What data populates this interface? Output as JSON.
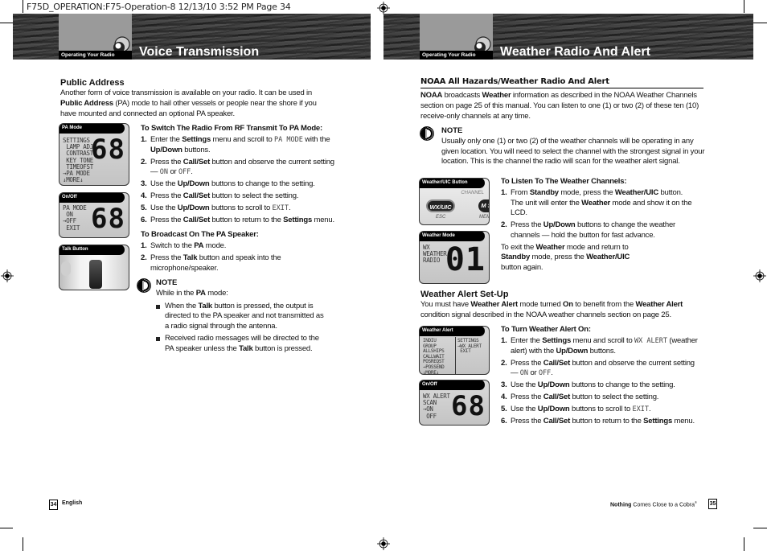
{
  "slug": "F75D_OPERATION:F75-Operation-8  12/13/10  3:52 PM  Page 34",
  "left_page": {
    "section_tab": "Operating Your Radio",
    "title": "Voice Transmission",
    "public_address": {
      "heading": "Public Address",
      "para": [
        {
          "t": "Another form of voice transmission is available on your radio. It can be used in "
        },
        {
          "b": "Public Address"
        },
        {
          "t": " (PA) mode to hail other vessels or people near the shore if you have mounted and connected an optional PA speaker."
        }
      ]
    },
    "switch_pa": {
      "heading": "To Switch The Radio From RF Transmit To PA Mode:",
      "steps": [
        {
          "num": "1.",
          "parts": [
            {
              "t": "Enter the "
            },
            {
              "b": "Settings"
            },
            {
              "t": " menu and scroll to "
            },
            {
              "m": "PA MODE"
            },
            {
              "t": " with the "
            },
            {
              "b": "Up/Down"
            },
            {
              "t": " buttons."
            }
          ]
        },
        {
          "num": "2.",
          "parts": [
            {
              "t": "Press the "
            },
            {
              "b": "Call/Set"
            },
            {
              "t": " button and observe the current setting — "
            },
            {
              "m": "ON"
            },
            {
              "t": " or "
            },
            {
              "m": "OFF"
            },
            {
              "t": "."
            }
          ]
        },
        {
          "num": "3.",
          "parts": [
            {
              "t": "Use the "
            },
            {
              "b": "Up/Down"
            },
            {
              "t": " buttons to change to the setting."
            }
          ]
        },
        {
          "num": "4.",
          "parts": [
            {
              "t": "Press the "
            },
            {
              "b": "Call/Set"
            },
            {
              "t": " button to select the setting."
            }
          ]
        },
        {
          "num": "5.",
          "parts": [
            {
              "t": "Use the "
            },
            {
              "b": "Up/Down"
            },
            {
              "t": " buttons to scroll to "
            },
            {
              "m": "EXIT"
            },
            {
              "t": "."
            }
          ]
        },
        {
          "num": "6.",
          "parts": [
            {
              "t": "Press the "
            },
            {
              "b": "Call/Set"
            },
            {
              "t": " button to return to the "
            },
            {
              "b": "Settings"
            },
            {
              "t": " menu."
            }
          ]
        }
      ]
    },
    "broadcast": {
      "heading": "To Broadcast On The PA Speaker:",
      "steps": [
        {
          "num": "1.",
          "parts": [
            {
              "t": "Switch to the "
            },
            {
              "b": "PA"
            },
            {
              "t": " mode."
            }
          ]
        },
        {
          "num": "2.",
          "parts": [
            {
              "t": "Press the "
            },
            {
              "b": "Talk"
            },
            {
              "t": " button and speak into the microphone/speaker."
            }
          ]
        }
      ]
    },
    "note": {
      "title": "NOTE",
      "intro": [
        {
          "t": "While in the "
        },
        {
          "b": "PA"
        },
        {
          "t": " mode:"
        }
      ],
      "bullets": [
        [
          {
            "t": "When the "
          },
          {
            "b": "Talk"
          },
          {
            "t": " button is pressed, the output is directed to the PA speaker and not transmitted as a radio signal through the antenna."
          }
        ],
        [
          {
            "t": "Received radio messages will be directed to the PA speaker unless the "
          },
          {
            "b": "Talk"
          },
          {
            "t": " button is pressed."
          }
        ]
      ]
    },
    "panels": [
      {
        "label": "PA Mode",
        "menu": "SETTINGS\n LAMP ADJ\n CONTRAST\n KEY TONE\n TIMEOFST\n→PA MODE\n↓MORE↓",
        "digits": "68"
      },
      {
        "label": "On/Off",
        "menu": "PA MODE\n ON\n→OFF\n EXIT",
        "digits": "68"
      },
      {
        "label": "Talk Button"
      }
    ],
    "footer": {
      "page": "34",
      "text": "English"
    }
  },
  "right_page": {
    "section_tab": "Operating Your Radio",
    "title": "Weather Radio And Alert",
    "noaa": {
      "heading": "NOAA All Hazards/Weather Radio And Alert",
      "para": [
        {
          "b": "NOAA"
        },
        {
          "t": " broadcasts "
        },
        {
          "b": "Weather"
        },
        {
          "t": " information as described in the NOAA Weather Channels section on page 25 of this manual. You can listen to one (1) or two (2) of these ten (10) receive-only channels at any time."
        }
      ]
    },
    "note": {
      "title": "NOTE",
      "text": "Usually only one (1) or two (2) of the weather channels will be operating in any given location. You will need to select the channel with the strongest signal in your location. This is the channel the radio will scan for the weather alert signal."
    },
    "listen": {
      "heading": "To Listen To The Weather Channels:",
      "steps": [
        {
          "num": "1.",
          "parts": [
            {
              "t": "From "
            },
            {
              "b": "Standby"
            },
            {
              "t": " mode, press the "
            },
            {
              "b": "Weather/UIC"
            },
            {
              "t": " button. The unit will enter the "
            },
            {
              "b": "Weather"
            },
            {
              "t": " mode and show it on the LCD."
            }
          ]
        },
        {
          "num": "2.",
          "parts": [
            {
              "t": "Press the "
            },
            {
              "b": "Up/Down"
            },
            {
              "t": " buttons to change the weather channels — hold the button for fast advance."
            }
          ]
        }
      ],
      "exit": [
        {
          "t": "To exit the "
        },
        {
          "b": "Weather"
        },
        {
          "t": " mode and return to "
        },
        {
          "b": "Standby"
        },
        {
          "t": " mode, press the "
        },
        {
          "b": "Weather/UIC"
        },
        {
          "t": " button again."
        }
      ]
    },
    "alert_setup": {
      "heading": "Weather Alert Set-Up",
      "para": [
        {
          "t": "You must have "
        },
        {
          "b": "Weather Alert"
        },
        {
          "t": " mode turned "
        },
        {
          "b": "On"
        },
        {
          "t": " to benefit from the "
        },
        {
          "b": "Weather Alert"
        },
        {
          "t": " condition signal described in the NOAA weather channels section on page 25."
        }
      ]
    },
    "turn_on": {
      "heading": "To Turn Weather Alert On:",
      "steps": [
        {
          "num": "1.",
          "parts": [
            {
              "t": "Enter the "
            },
            {
              "b": "Settings"
            },
            {
              "t": " menu and scroll to "
            },
            {
              "m": "WX ALERT"
            },
            {
              "t": " (weather alert) with the "
            },
            {
              "b": "Up/Down"
            },
            {
              "t": " buttons."
            }
          ]
        },
        {
          "num": "2.",
          "parts": [
            {
              "t": "Press the "
            },
            {
              "b": "Call/Set"
            },
            {
              "t": " button and observe the current setting — "
            },
            {
              "m": "ON"
            },
            {
              "t": " or "
            },
            {
              "m": "OFF"
            },
            {
              "t": "."
            }
          ]
        },
        {
          "num": "3.",
          "parts": [
            {
              "t": "Use the "
            },
            {
              "b": "Up/Down"
            },
            {
              "t": " buttons to change to the setting."
            }
          ]
        },
        {
          "num": "4.",
          "parts": [
            {
              "t": "Press the "
            },
            {
              "b": "Call/Set"
            },
            {
              "t": " button to select the setting."
            }
          ]
        },
        {
          "num": "5.",
          "parts": [
            {
              "t": "Use the "
            },
            {
              "b": "Up/Down"
            },
            {
              "t": " buttons to scroll to "
            },
            {
              "m": "EXIT"
            },
            {
              "t": "."
            }
          ]
        },
        {
          "num": "6.",
          "parts": [
            {
              "t": "Press the "
            },
            {
              "b": "Call/Set"
            },
            {
              "t": " button to return to the "
            },
            {
              "b": "Settings"
            },
            {
              "t": " menu."
            }
          ]
        }
      ]
    },
    "panels": [
      {
        "label": "Weather/UIC Button",
        "channel": "CHANNEL",
        "btn1": "WX/UIC",
        "btn2": "M S",
        "esc": "ESC",
        "mem": "MEM"
      },
      {
        "label": "Weather Mode",
        "menu": "WX\nWEATHER\nRADIO",
        "digits": "01"
      },
      {
        "label": "Weather Alert",
        "menu_left": "INDIU\nGROUP\nALLSHIPS\nCALLWAIT\nPOSREQST\n→POSSEND\n↓MORE↓",
        "menu_right": "SETTINGS\n→WX ALERT\n EXIT"
      },
      {
        "label": "On/Off",
        "menu": "WX ALERT\nSCAN\n→ON\n OFF",
        "digits": "68"
      }
    ],
    "footer": {
      "brand_bold": "Nothing",
      "brand_rest": " Comes Close to a Cobra",
      "reg_mark": "®",
      "page": "35"
    }
  }
}
